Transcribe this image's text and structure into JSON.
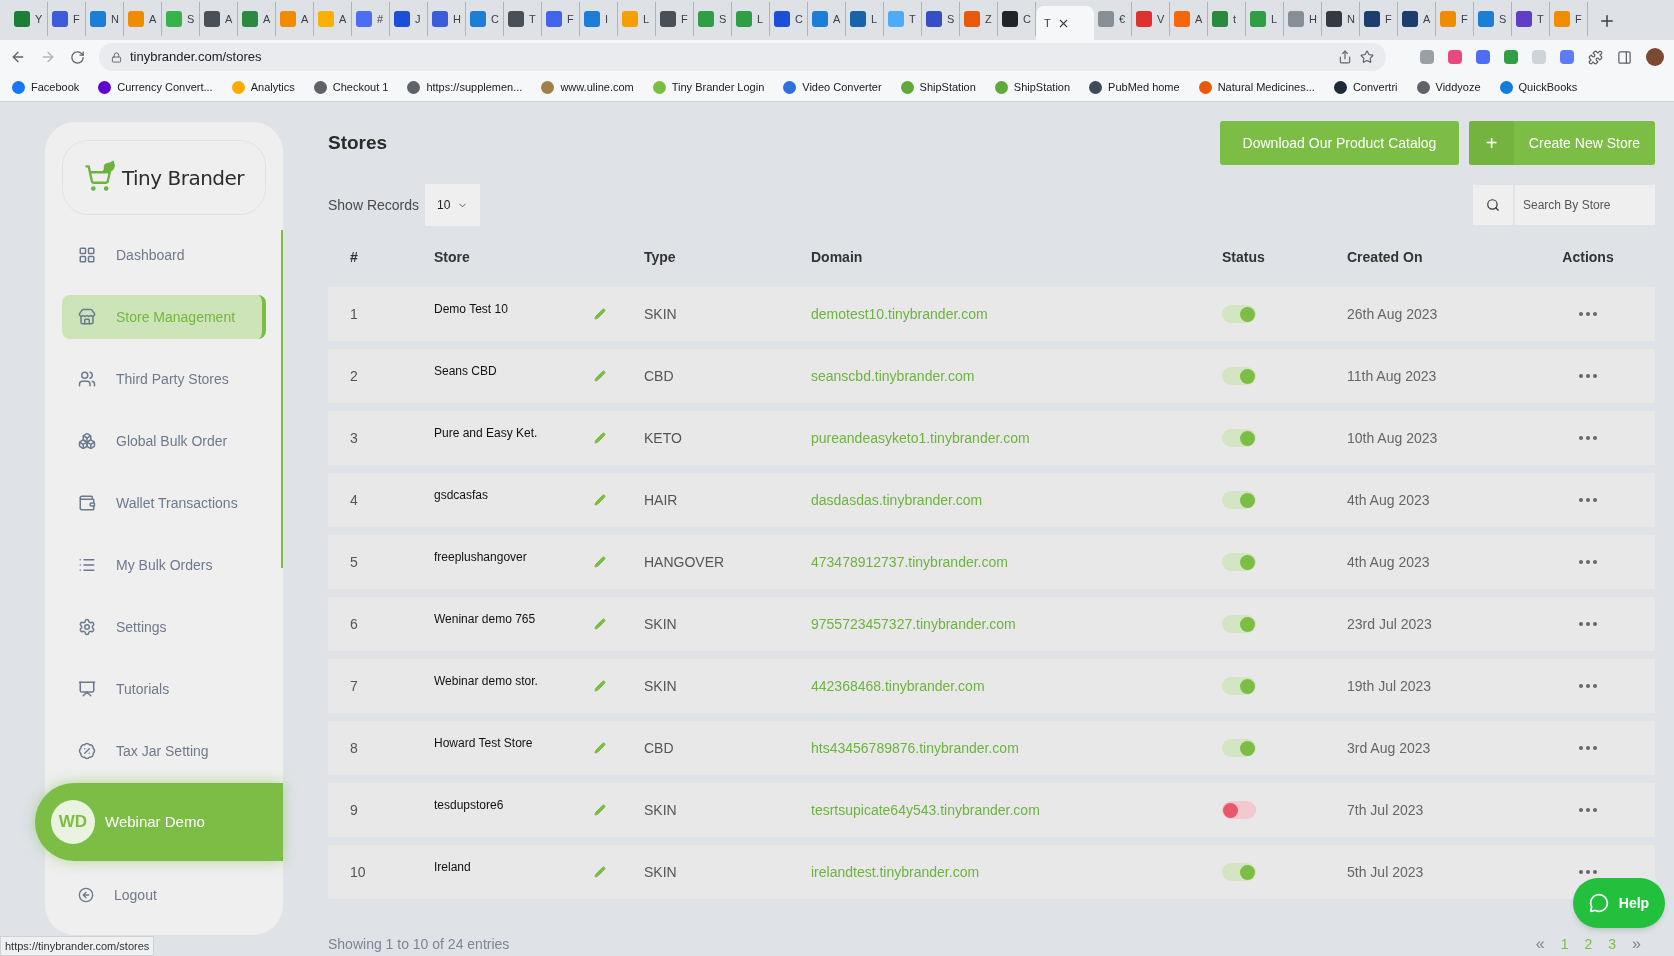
{
  "browser": {
    "tabs": [
      {
        "title": "Y",
        "selected": false
      },
      {
        "title": "F",
        "selected": false
      },
      {
        "title": "N",
        "selected": false
      },
      {
        "title": "A",
        "selected": false
      },
      {
        "title": "S",
        "selected": false
      },
      {
        "title": "A",
        "selected": false
      },
      {
        "title": "A",
        "selected": false
      },
      {
        "title": "A",
        "selected": false
      },
      {
        "title": "A",
        "selected": false
      },
      {
        "title": "#",
        "selected": false
      },
      {
        "title": "J",
        "selected": false
      },
      {
        "title": "H",
        "selected": false
      },
      {
        "title": "C",
        "selected": false
      },
      {
        "title": "T",
        "selected": false
      },
      {
        "title": "F",
        "selected": false
      },
      {
        "title": "I",
        "selected": false
      },
      {
        "title": "L",
        "selected": false
      },
      {
        "title": "F",
        "selected": false
      },
      {
        "title": "S",
        "selected": false
      },
      {
        "title": "L",
        "selected": false
      },
      {
        "title": "C",
        "selected": false
      },
      {
        "title": "A",
        "selected": false
      },
      {
        "title": "L",
        "selected": false
      },
      {
        "title": "T",
        "selected": false
      },
      {
        "title": "S",
        "selected": false
      },
      {
        "title": "Z",
        "selected": false
      },
      {
        "title": "C",
        "selected": false
      },
      {
        "title": "T",
        "selected": true
      },
      {
        "title": "€",
        "selected": false
      },
      {
        "title": "V",
        "selected": false
      },
      {
        "title": "A",
        "selected": false
      },
      {
        "title": "t",
        "selected": false
      },
      {
        "title": "L",
        "selected": false
      },
      {
        "title": "H",
        "selected": false
      },
      {
        "title": "N",
        "selected": false
      },
      {
        "title": "F",
        "selected": false
      },
      {
        "title": "A",
        "selected": false
      },
      {
        "title": "F",
        "selected": false
      },
      {
        "title": "S",
        "selected": false
      },
      {
        "title": "T",
        "selected": false
      },
      {
        "title": "F",
        "selected": false
      }
    ],
    "url": "tinybrander.com/stores",
    "bookmarks": [
      {
        "label": "Facebook",
        "color": "#1877f2"
      },
      {
        "label": "Currency Convert...",
        "color": "#6001d2"
      },
      {
        "label": "Analytics",
        "color": "#f9ab00"
      },
      {
        "label": "Checkout 1",
        "color": "#5f6368"
      },
      {
        "label": "https://supplemen...",
        "color": "#5f6368"
      },
      {
        "label": "www.uline.com",
        "color": "#a0804a"
      },
      {
        "label": "Tiny Brander Login",
        "color": "#7cbd45"
      },
      {
        "label": "Video Converter",
        "color": "#2f6fde"
      },
      {
        "label": "ShipStation",
        "color": "#5fa83a"
      },
      {
        "label": "ShipStation",
        "color": "#5fa83a"
      },
      {
        "label": "PubMed home",
        "color": "#3c4a5c"
      },
      {
        "label": "Natural Medicines...",
        "color": "#e8590c"
      },
      {
        "label": "Convertri",
        "color": "#1f2937"
      },
      {
        "label": "Viddyoze",
        "color": "#5f6368"
      },
      {
        "label": "QuickBooks",
        "color": "#0f7ddb"
      }
    ]
  },
  "sidebar": {
    "brand": "Tiny Brander",
    "nav": [
      {
        "label": "Dashboard",
        "selected": false
      },
      {
        "label": "Store Management",
        "selected": true
      },
      {
        "label": "Third Party Stores",
        "selected": false
      },
      {
        "label": "Global Bulk Order",
        "selected": false
      },
      {
        "label": "Wallet Transactions",
        "selected": false
      },
      {
        "label": "My Bulk Orders",
        "selected": false
      },
      {
        "label": "Settings",
        "selected": false
      },
      {
        "label": "Tutorials",
        "selected": false
      },
      {
        "label": "Tax Jar Setting",
        "selected": false
      }
    ],
    "user": {
      "initials": "WD",
      "name": "Webinar Demo"
    },
    "logout": "Logout"
  },
  "main": {
    "title": "Stores",
    "buttons": {
      "download": "Download Our Product Catalog",
      "create_icon": "+",
      "create": "Create New Store"
    },
    "show_records": {
      "label": "Show Records",
      "value": "10"
    },
    "search": {
      "placeholder": "Search By Store"
    },
    "table": {
      "columns": [
        "#",
        "Store",
        "Type",
        "Domain",
        "Status",
        "Created On",
        "Actions"
      ],
      "rows": [
        {
          "index": "1",
          "store": "Demo Test 10",
          "type": "SKIN",
          "domain": "demotest10.tinybrander.com",
          "on": true,
          "created": "26th Aug 2023"
        },
        {
          "index": "2",
          "store": "Seans CBD",
          "type": "CBD",
          "domain": "seanscbd.tinybrander.com",
          "on": true,
          "created": "11th Aug 2023"
        },
        {
          "index": "3",
          "store": "Pure and Easy Ket.",
          "type": "KETO",
          "domain": "pureandeasyketo1.tinybrander.com",
          "on": true,
          "created": "10th Aug 2023"
        },
        {
          "index": "4",
          "store": "gsdcasfas",
          "type": "HAIR",
          "domain": "dasdasdas.tinybrander.com",
          "on": true,
          "created": "4th Aug 2023"
        },
        {
          "index": "5",
          "store": "freeplushangover",
          "type": "HANGOVER",
          "domain": "473478912737.tinybrander.com",
          "on": true,
          "created": "4th Aug 2023"
        },
        {
          "index": "6",
          "store": "Weninar demo 765",
          "type": "SKIN",
          "domain": "9755723457327.tinybrander.com",
          "on": true,
          "created": "23rd Jul 2023"
        },
        {
          "index": "7",
          "store": "Webinar demo stor.",
          "type": "SKIN",
          "domain": "442368468.tinybrander.com",
          "on": true,
          "created": "19th Jul 2023"
        },
        {
          "index": "8",
          "store": "Howard Test Store",
          "type": "CBD",
          "domain": "hts43456789876.tinybrander.com",
          "on": true,
          "created": "3rd Aug 2023"
        },
        {
          "index": "9",
          "store": "tesdupstore6",
          "type": "SKIN",
          "domain": "tesrtsupicate64y543.tinybrander.com",
          "on": false,
          "created": "7th Jul 2023"
        },
        {
          "index": "10",
          "store": "Ireland",
          "type": "SKIN",
          "domain": "irelandtest.tinybrander.com",
          "on": true,
          "created": "5th Jul 2023"
        }
      ]
    },
    "footer": "Showing 1 to 10 of 24 entries",
    "pagination": [
      "«",
      "1",
      "2",
      "3",
      "»"
    ]
  },
  "help": "Help",
  "status_url": "https://tinybrander.com/stores"
}
